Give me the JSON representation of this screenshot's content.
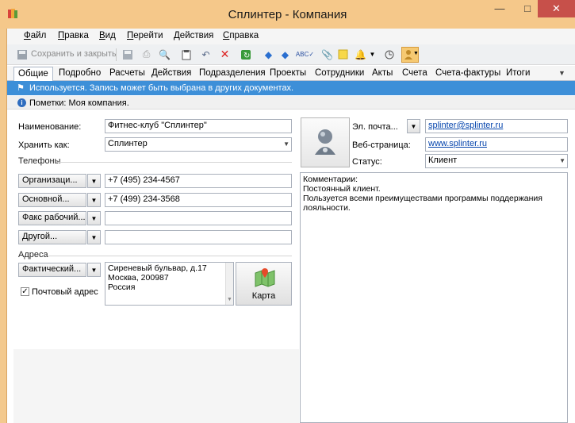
{
  "window": {
    "title": "Сплинтер - Компания",
    "min_icon": "minimize-icon",
    "max_icon": "maximize-icon",
    "close_icon": "close-icon"
  },
  "menu": [
    "Файл",
    "Правка",
    "Вид",
    "Перейти",
    "Действия",
    "Справка"
  ],
  "toolbar": {
    "save_close_label": "Сохранить и закрыть"
  },
  "tabs": [
    "Общие",
    "Подробно",
    "Расчеты",
    "Действия",
    "Подразделения",
    "Проекты",
    "Сотрудники",
    "Акты",
    "Счета",
    "Счета-фактуры",
    "Итоги"
  ],
  "active_tab": "Общие",
  "infobar": {
    "text": "Используется. Запись может быть выбрана в других документах."
  },
  "notebar": {
    "text": "Пометки: Моя компания."
  },
  "form": {
    "name_label": "Наименование:",
    "name_value": "Фитнес-клуб \"Сплинтер\"",
    "store_as_label": "Хранить как:",
    "store_as_value": "Сплинтер",
    "phones_header": "Телефоны",
    "phones": [
      {
        "type": "Организаци...",
        "value": "+7 (495) 234-4567"
      },
      {
        "type": "Основной...",
        "value": "+7 (499) 234-3568"
      },
      {
        "type": "Факс рабочий...",
        "value": ""
      },
      {
        "type": "Другой...",
        "value": ""
      }
    ],
    "addresses_header": "Адреса",
    "address_type": "Фактический...",
    "address_lines": [
      "Сиреневый бульвар, д.17",
      "Москва, 200987",
      "Россия"
    ],
    "postal_checkbox_label": "Почтовый адрес",
    "map_button_label": "Карта",
    "email_button_label": "Эл. почта...",
    "email_value": "splinter@splinter.ru",
    "web_label": "Веб-страница:",
    "web_value": "www.splinter.ru",
    "status_label": "Статус:",
    "status_value": "Клиент",
    "comments": [
      "Комментарии:",
      "Постоянный клиент.",
      "Пользуется всеми преимуществами программы поддержания",
      "лояльности."
    ]
  }
}
